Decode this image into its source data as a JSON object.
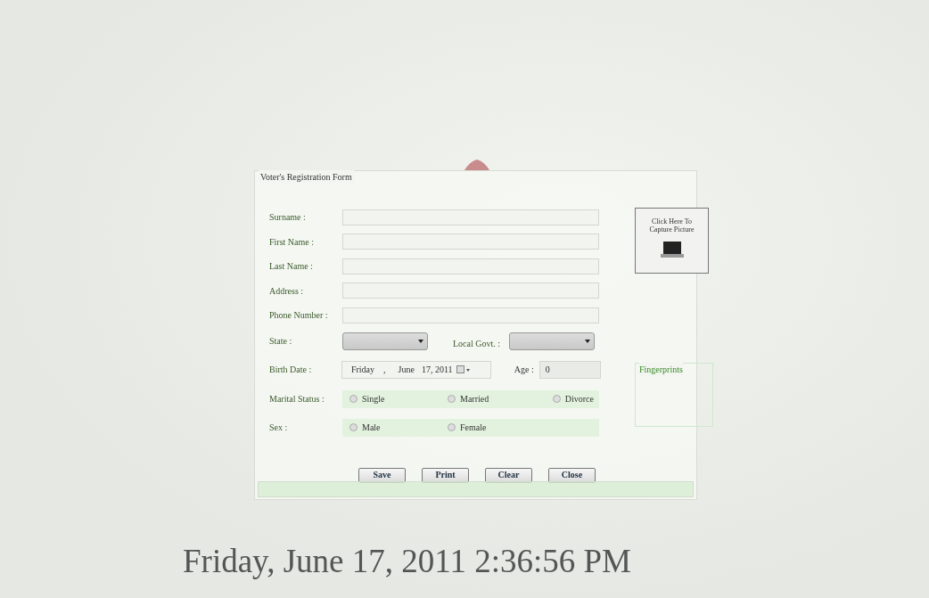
{
  "form": {
    "title": "Voter's Registration Form",
    "text_fields": [
      {
        "label": "Surname :"
      },
      {
        "label": "First Name :"
      },
      {
        "label": "Last Name :"
      },
      {
        "label": "Address :"
      },
      {
        "label": "Phone Number :"
      }
    ],
    "state": {
      "label": "State :"
    },
    "local_govt": {
      "label": "Local Govt. :"
    },
    "birth_date": {
      "label": "Birth Date :",
      "weekday": "Friday",
      "separator": ",",
      "month": "June",
      "day_year": "17, 2011"
    },
    "age": {
      "label": "Age :",
      "value": "0"
    },
    "marital_status": {
      "label": "Marital Status :",
      "options": [
        {
          "label": "Single",
          "checked": false
        },
        {
          "label": "Married",
          "checked": false
        },
        {
          "label": "Divorce",
          "checked": false
        }
      ]
    },
    "sex": {
      "label": "Sex :",
      "options": [
        {
          "label": "Male",
          "checked": false
        },
        {
          "label": "Female",
          "checked": false
        }
      ]
    },
    "buttons": [
      "Save",
      "Print",
      "Clear",
      "Close"
    ],
    "capture": {
      "lines": [
        "Click Here To",
        "Capture Picture"
      ]
    },
    "fingerprints": {
      "title": "Fingerprints"
    }
  },
  "clock": "Friday, June 17, 2011 2:36:56 PM"
}
